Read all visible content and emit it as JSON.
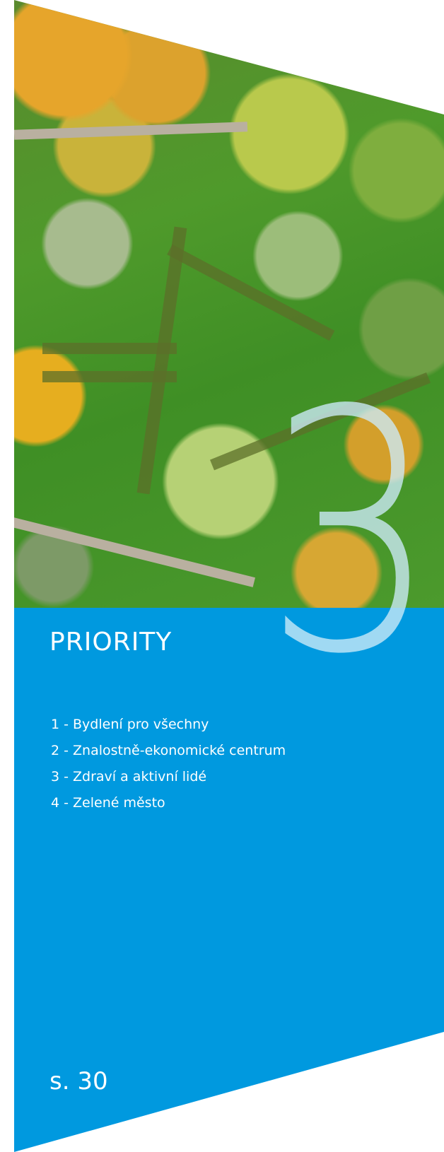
{
  "section": {
    "number": "3",
    "title": "PRIORITY",
    "items": [
      "1 - Bydlení pro všechny",
      "2 - Znalostně-ekonomické centrum",
      "3 - Zdraví a aktivní lidé",
      "4 - Zelené město"
    ],
    "page_ref": "s. 30"
  },
  "colors": {
    "panel_blue": "#0099df",
    "text": "#ffffff",
    "number_overlay": "#cdebf8"
  }
}
